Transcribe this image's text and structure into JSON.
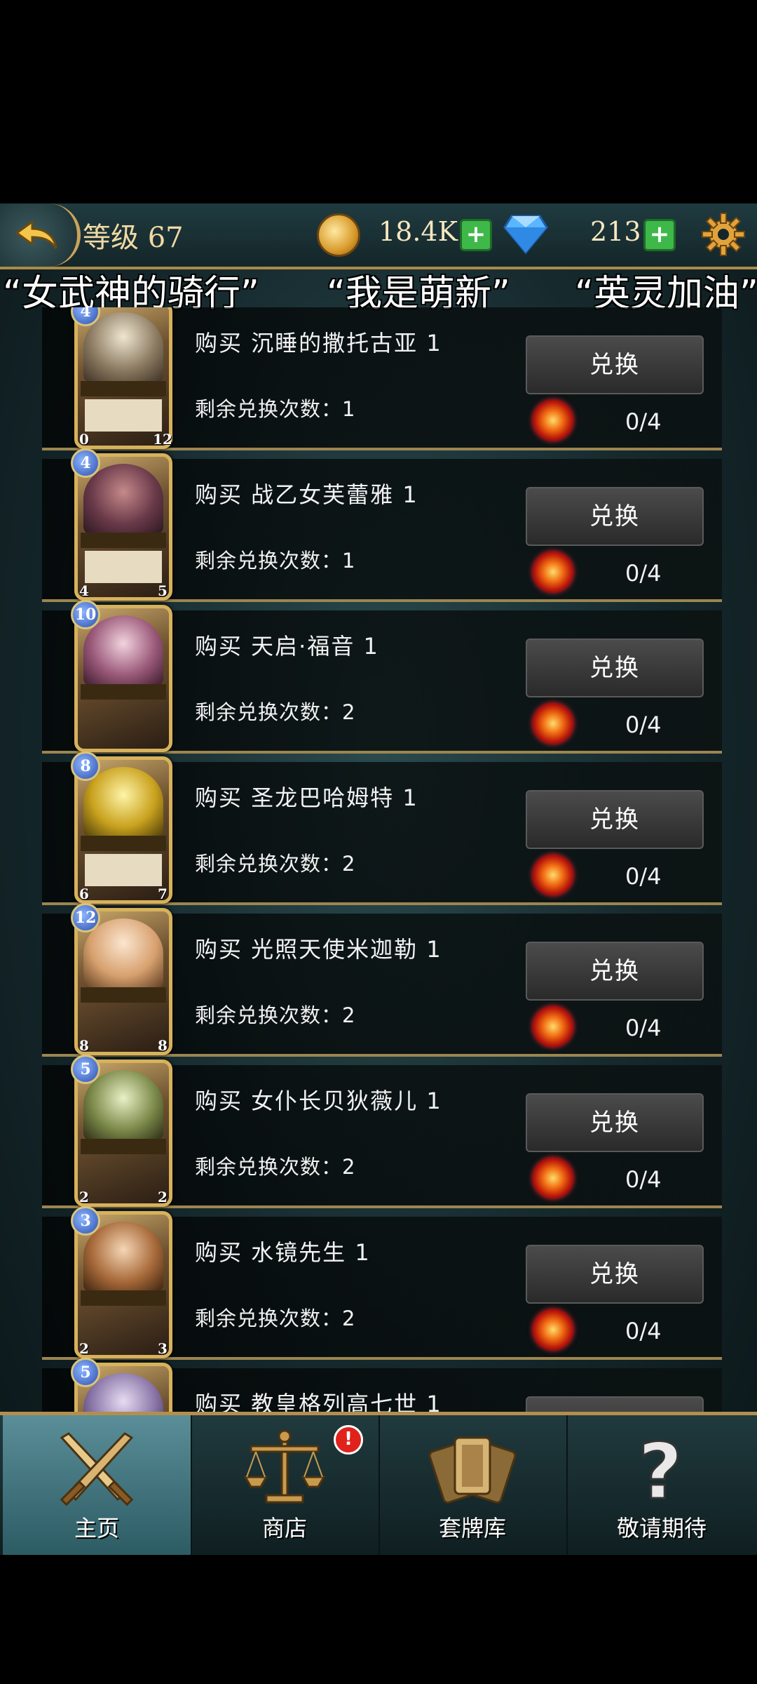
{
  "header": {
    "level_label": "等级 67",
    "coins": "18.4K",
    "gems": "213"
  },
  "marquee": [
    "“女武神的骑行”",
    "“我是萌新”",
    "“英灵加油”"
  ],
  "items": [
    {
      "cost": "4",
      "atk": "0",
      "hp": "12",
      "buy": "购买 沉睡的撒托古亚 1",
      "remain": "剩余兑换次数：1",
      "count": "0/4"
    },
    {
      "cost": "4",
      "atk": "4",
      "hp": "5",
      "buy": "购买 战乙女芙蕾雅  1",
      "remain": "剩余兑换次数：1",
      "count": "0/4"
    },
    {
      "cost": "10",
      "atk": "",
      "hp": "",
      "buy": "购买 天启·福音  1",
      "remain": "剩余兑换次数：2",
      "count": "0/4"
    },
    {
      "cost": "8",
      "atk": "6",
      "hp": "7",
      "buy": "购买 圣龙巴哈姆特  1",
      "remain": "剩余兑换次数：2",
      "count": "0/4"
    },
    {
      "cost": "12",
      "atk": "8",
      "hp": "8",
      "buy": "购买 光照天使米迦勒  1",
      "remain": "剩余兑换次数：2",
      "count": "0/4"
    },
    {
      "cost": "5",
      "atk": "2",
      "hp": "2",
      "buy": "购买 女仆长贝狄薇儿  1",
      "remain": "剩余兑换次数：2",
      "count": "0/4"
    },
    {
      "cost": "3",
      "atk": "2",
      "hp": "3",
      "buy": "购买 水镜先生  1",
      "remain": "剩余兑换次数：2",
      "count": "0/4"
    },
    {
      "cost": "5",
      "atk": "",
      "hp": "",
      "buy": "购买 教皇格列高七世  1",
      "remain": "",
      "count": ""
    }
  ],
  "exchange_label": "兑换",
  "nav": {
    "home": "主页",
    "shop": "商店",
    "shop_badge": "!",
    "deck": "套牌库",
    "coming_soon": "敬请期待"
  }
}
